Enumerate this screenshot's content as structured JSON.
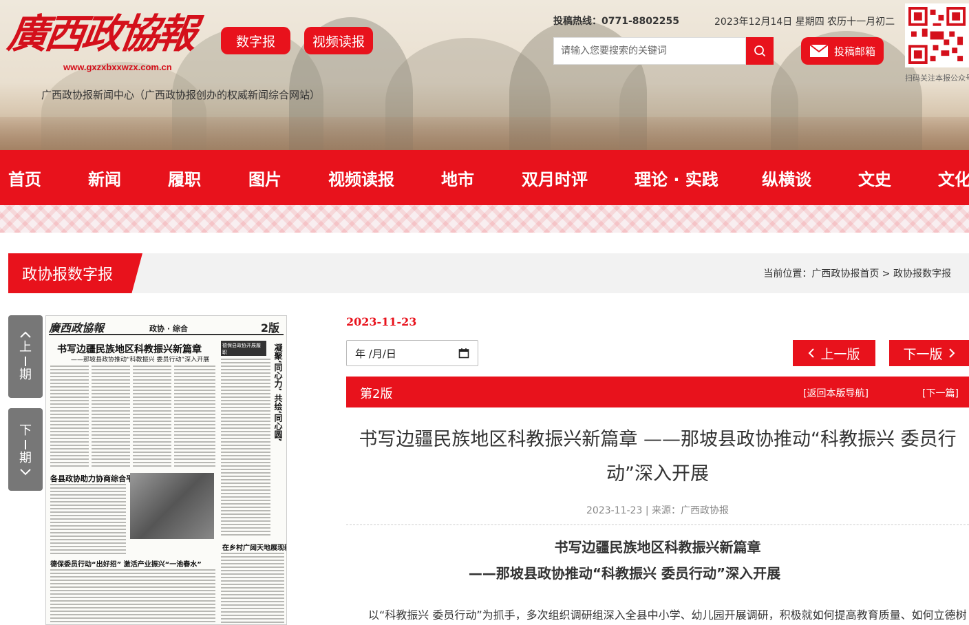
{
  "header": {
    "logo_text": "廣西政協報",
    "logo_url": "www.gxzxbxxwzx.com.cn",
    "tagline": "广西政协报新闻中心（广西政协报创办的权威新闻综合网站）",
    "btn_digital": "数字报",
    "btn_video": "视频读报",
    "hotline": "投稿热线：0771-8802255",
    "date": "2023年12月14日 星期四 农历十一月初二",
    "search_placeholder": "请输入您要搜索的关键词",
    "mail_label": "投稿邮箱",
    "qr_caption": "扫码关注本报公众号"
  },
  "nav": {
    "items": [
      "首页",
      "新闻",
      "履职",
      "图片",
      "视频读报",
      "地市",
      "双月时评",
      "理论 · 实践",
      "纵横谈",
      "文史",
      "文化"
    ]
  },
  "section": {
    "title": "政协报数字报",
    "breadcrumb_prefix": "当前位置：",
    "breadcrumb_home": "广西政协报首页",
    "breadcrumb_sep": " > ",
    "breadcrumb_current": "政协报数字报"
  },
  "side": {
    "prev": [
      "上",
      "期"
    ],
    "next": [
      "下",
      "期"
    ]
  },
  "paper": {
    "logo": "廣西政協報",
    "section": "政协 · 综合",
    "page_num": "2版",
    "headline": "书写边疆民族地区科教振兴新篇章",
    "subhead": "——那坡县政协推动“科教振兴 委员行动”深入开展",
    "side_box": "德保县政协开展履职",
    "vertical": "凝聚‘同心力’ 共绘‘同心圆’",
    "h2": "各县政协助力协商综合平面发展",
    "h3": "德保委员行动“出好招” 激活产业振兴“一池春水”",
    "h4": "在乡村广阔天地展现新作为"
  },
  "article": {
    "issue_date": "2023-11-23",
    "date_input": "年 /月/日",
    "prev_ver": "上一版",
    "next_ver": "下一版",
    "version_label": "第2版",
    "back_nav": "[返回本版导航]",
    "next_article": "[下一篇]",
    "title": "书写边疆民族地区科教振兴新篇章 ——那坡县政协推动“科教振兴 委员行动”深入开展",
    "meta_date": "2023-11-23",
    "meta_source_label": " | 来源：",
    "meta_source": "广西政协报",
    "heading_1": "书写边疆民族地区科教振兴新篇章",
    "heading_2": "——那坡县政协推动“科教振兴 委员行动”深入开展",
    "body": "以“科教振兴 委员行动”为抓手，多次组织调研组深入全县中小学、幼儿园开展调研，积极就如何提高教育质量、如何立德树"
  },
  "colors": {
    "brand_red": "#e8121c",
    "tab_gray": "#777777"
  }
}
